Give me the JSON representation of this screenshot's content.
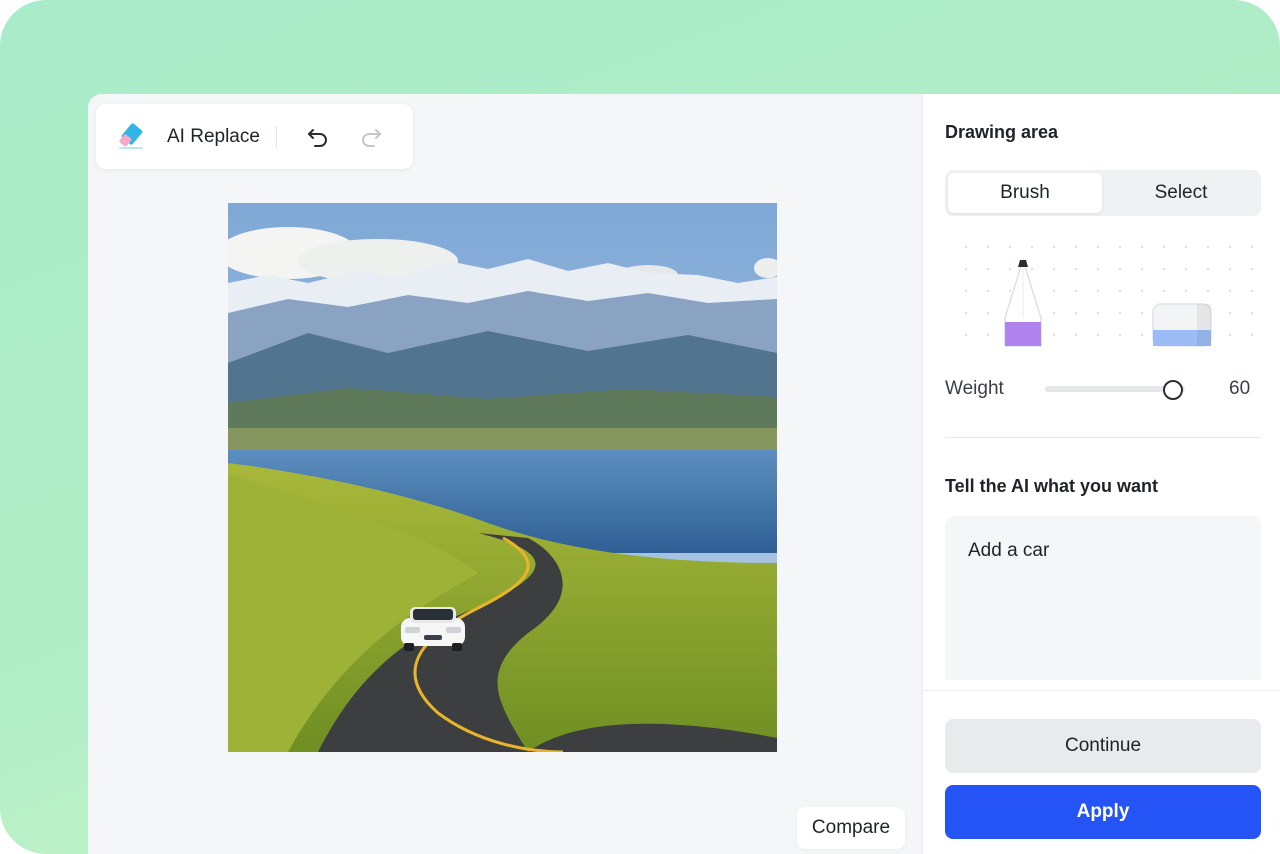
{
  "toolbar": {
    "icon": "eraser-icon",
    "title": "AI Replace",
    "undo_icon": "undo-icon",
    "redo_icon": "redo-icon"
  },
  "canvas": {
    "compare_label": "Compare"
  },
  "panel": {
    "drawing_area_title": "Drawing area",
    "mode_tabs": [
      {
        "label": "Brush",
        "active": true
      },
      {
        "label": "Select",
        "active": false
      }
    ],
    "tools": [
      "pencil-icon",
      "eraser-icon"
    ],
    "weight_label": "Weight",
    "weight_value": "60",
    "weight_fraction": 0.9,
    "prompt_title": "Tell the AI what you want",
    "prompt_value": "Add a car",
    "continue_label": "Continue",
    "apply_label": "Apply"
  },
  "colors": {
    "accent": "#2454f5",
    "background_gradient_start": "#a9ecc9",
    "background_gradient_end": "#d9f7c6",
    "pencil_tip": "#b083ee",
    "eraser_tip": "#9dbbf6"
  }
}
